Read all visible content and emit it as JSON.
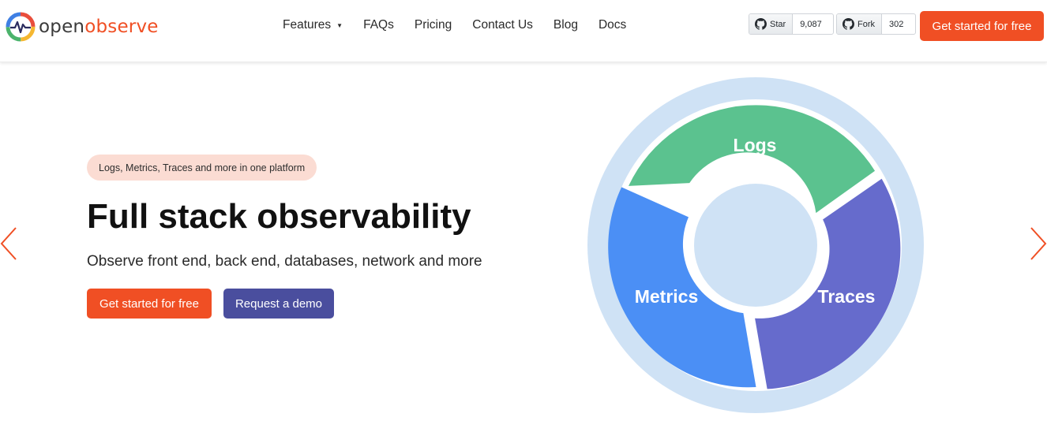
{
  "brand": {
    "part1": "open",
    "part2": "observe"
  },
  "nav": {
    "items": [
      {
        "label": "Features",
        "has_dropdown": true
      },
      {
        "label": "FAQs"
      },
      {
        "label": "Pricing"
      },
      {
        "label": "Contact Us"
      },
      {
        "label": "Blog"
      },
      {
        "label": "Docs"
      }
    ]
  },
  "github": {
    "star_label": "Star",
    "star_count": "9,087",
    "fork_label": "Fork",
    "fork_count": "302"
  },
  "header_cta": "Get started for free",
  "hero": {
    "badge": "Logs, Metrics, Traces and more in one platform",
    "title": "Full stack observability",
    "subtitle": "Observe front end, back end, databases, network and more",
    "primary_button": "Get started for free",
    "secondary_button": "Request a demo"
  },
  "wheel": {
    "segments": [
      {
        "label": "Logs",
        "color": "#5bc28f"
      },
      {
        "label": "Traces",
        "color": "#666bcc"
      },
      {
        "label": "Metrics",
        "color": "#4b8ff5"
      }
    ],
    "ring_color": "#cfe2f5"
  },
  "colors": {
    "accent": "#f04f24",
    "demo": "#4a4e9e",
    "badge_bg": "#fbdcd3"
  },
  "icons": [
    "openobserve-logo-icon",
    "caret-down-icon",
    "github-icon",
    "chevron-left-icon",
    "chevron-right-icon"
  ]
}
